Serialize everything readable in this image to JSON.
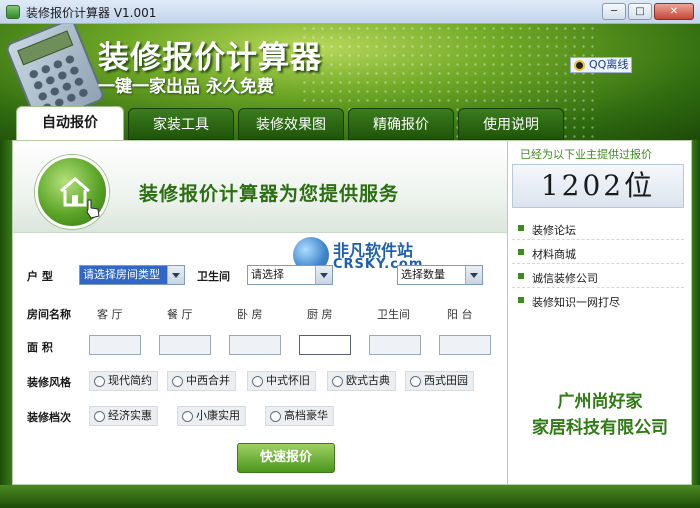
{
  "window": {
    "title": "装修报价计算器  V1.001",
    "minimize_glyph": "─",
    "maximize_glyph": "□",
    "close_glyph": "✕"
  },
  "header": {
    "title": "装修报价计算器",
    "subtitle": "一键一家出品 永久免费",
    "qq_status": "QQ离线",
    "qq_icon": "qq-penguin-icon",
    "calculator_icon": "calculator-icon"
  },
  "tabs": [
    {
      "label": "自动报价",
      "active": true
    },
    {
      "label": "家装工具",
      "active": false
    },
    {
      "label": "装修效果图",
      "active": false
    },
    {
      "label": "精确报价",
      "active": false
    },
    {
      "label": "使用说明",
      "active": false
    }
  ],
  "banner": {
    "text": "装修报价计算器为您提供服务",
    "icon": "home-click-icon"
  },
  "watermark": {
    "title": "非凡软件站",
    "subtitle": "CRSKY.com"
  },
  "form": {
    "house_type_label": "户    型",
    "house_type_value": "请选择房间类型",
    "bathroom_label": "卫生间",
    "bathroom_value": "请选择",
    "bathroom_count_value": "选择数量",
    "room_name_label": "房间名称",
    "rooms": [
      "客  厅",
      "餐  厅",
      "卧  房",
      "厨  房",
      "卫生间",
      "阳  台"
    ],
    "area_label": "面    积",
    "style_label": "装修风格",
    "styles": [
      "现代简约",
      "中西合并",
      "中式怀旧",
      "欧式古典",
      "西式田园"
    ],
    "grade_label": "装修档次",
    "grades": [
      "经济实惠",
      "小康实用",
      "高档豪华"
    ],
    "quote_button": "快速报价"
  },
  "side": {
    "heading": "已经为以下业主提供过报价",
    "count": "1202位",
    "links": [
      "装修论坛",
      "材料商城",
      "诚信装修公司",
      "装修知识一网打尽"
    ],
    "company_line1": "广州尚好家",
    "company_line2": "家居科技有限公司"
  },
  "colors": {
    "brand_green": "#2f7c14",
    "header_green": "#6fa826",
    "link_bullet": "#3e8d1a",
    "select_highlight": "#3168c6"
  }
}
